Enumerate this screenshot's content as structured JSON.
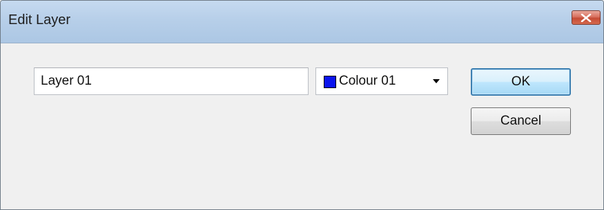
{
  "window": {
    "title": "Edit Layer",
    "close_icon": "close-x-icon"
  },
  "form": {
    "layer_name_value": "Layer 01",
    "colour": {
      "selected_label": "Colour 01",
      "swatch_color": "#0b14ee",
      "dropdown_icon": "triangle-down-icon"
    }
  },
  "buttons": {
    "ok_label": "OK",
    "cancel_label": "Cancel"
  },
  "colors": {
    "title_bar": "#b9d1ea",
    "close_button": "#c75050",
    "dialog_background": "#f0f0f0",
    "default_button_border": "#3c7fb1"
  }
}
